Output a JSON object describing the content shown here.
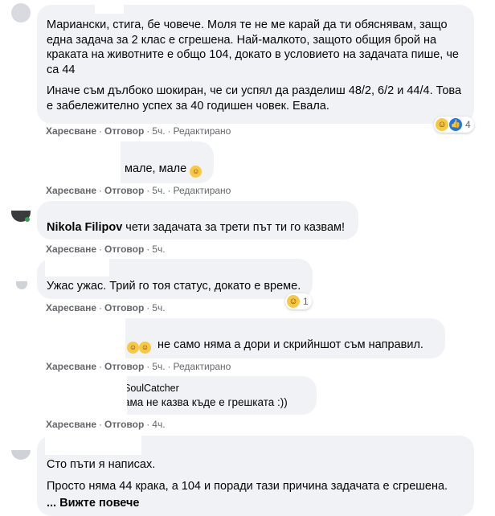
{
  "labels": {
    "like": "Харесване",
    "reply": "Отговор",
    "edited": "Редактирано",
    "dot": "·"
  },
  "comments": [
    {
      "author": "",
      "para1": "Мариански, стига, бе човече. Моля те не ме карай да ти обяснявам, защо една задача за 2 клас е сгрешена. Най-малкото, защото общия брой на краката на животните е общо 104, докато в условието на задачата пише, че са 44",
      "para2": "Иначе съм дълбоко шокиран, че си успял да разделиш 48/2, 6/2 и 44/4. Това е забележително успех за 40 годишен човек. Евала.",
      "time": "5ч.",
      "edited": true,
      "reaction_count": "4"
    },
    {
      "author": "",
      "text": "мале, мале",
      "time": "5ч.",
      "edited": true
    },
    {
      "author": "Nikola Filipov",
      "text": "чети задачата за трети път ти го казвам!",
      "time": "5ч."
    },
    {
      "author": "",
      "text": "Ужас ужас. Трий го тоя статус, докато е време.",
      "time": "5ч.",
      "reaction_count": "1"
    },
    {
      "author": "",
      "text": "не само няма а дори и скрийншот съм направил.",
      "time": "5ч.",
      "edited": true
    },
    {
      "author": "SoulCatcher",
      "text": "ама не казва къде е грешката :))",
      "time": "4ч."
    },
    {
      "author": "",
      "para1": "Сто пъти я написах.",
      "para2": "Просто няма 44 крака, а 104 и поради тази причина задачата е сгрешена.",
      "see_more": "... Вижте повече"
    }
  ]
}
